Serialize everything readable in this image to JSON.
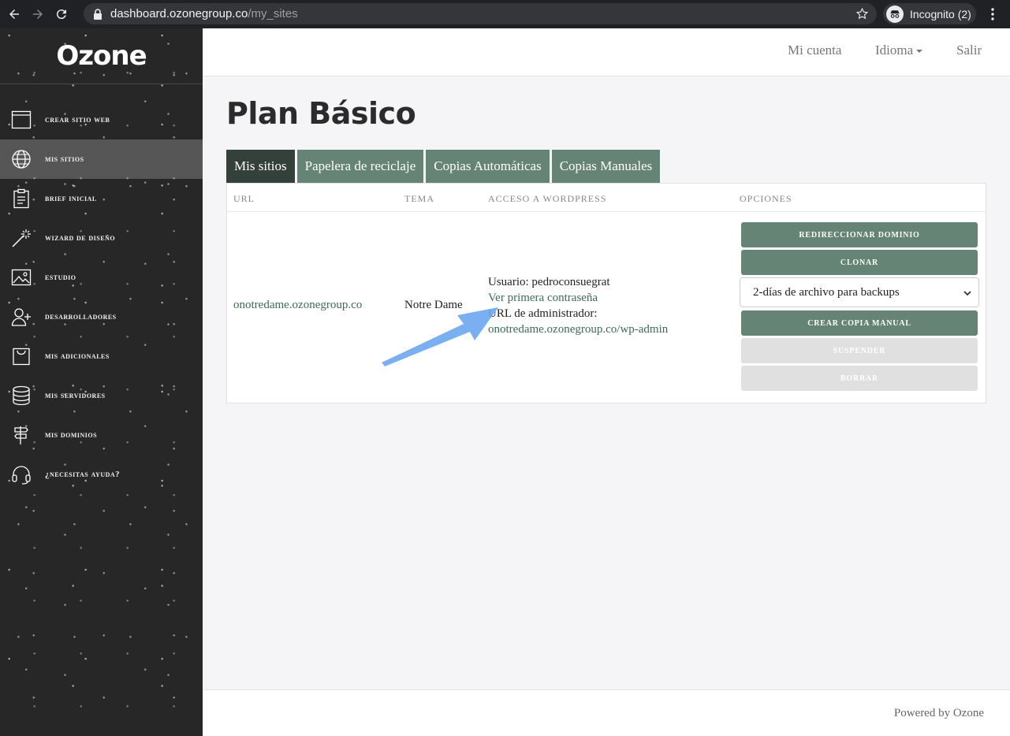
{
  "browser": {
    "url_host": "dashboard.ozonegroup.co",
    "url_path": "/my_sites",
    "incognito_label": "Incognito (2)"
  },
  "sidebar": {
    "logo": "Ozone",
    "items": [
      {
        "label": "Crear sitio web",
        "icon": "browser-window-icon"
      },
      {
        "label": "Mis sitios",
        "icon": "globe-icon",
        "active": true
      },
      {
        "label": "Brief inicial",
        "icon": "clipboard-icon"
      },
      {
        "label": "Wizard de diseño",
        "icon": "magic-wand-icon"
      },
      {
        "label": "Estudio",
        "icon": "image-icon"
      },
      {
        "label": "Desarrolladores",
        "icon": "add-user-icon"
      },
      {
        "label": "Mis adicionales",
        "icon": "shopping-bag-icon"
      },
      {
        "label": "Mis servidores",
        "icon": "database-icon"
      },
      {
        "label": "Mis dominios",
        "icon": "signpost-icon"
      },
      {
        "label": "¿Necesitas ayuda?",
        "icon": "headset-icon"
      }
    ]
  },
  "topnav": {
    "account": "Mi cuenta",
    "language": "Idioma",
    "logout": "Salir"
  },
  "main": {
    "title": "Plan Básico",
    "tabs": [
      "Mis sitios",
      "Papelera de reciclaje",
      "Copias Automáticas",
      "Copias Manuales"
    ],
    "table": {
      "headers": [
        "URL",
        "TEMA",
        "ACCESO A WORDPRESS",
        "OPCIONES"
      ],
      "row": {
        "url": "onotredame.ozonegroup.co",
        "theme": "Notre Dame",
        "user_line": "Usuario: pedroconsuegrat",
        "password_link": "Ver primera contraseña",
        "admin_label": "URL de administrador:",
        "admin_url": "onotredame.ozonegroup.co/wp-admin"
      }
    },
    "options": {
      "redirect": "REDIRECCIONAR DOMINIO",
      "clone": "CLONAR",
      "backup_select": "2-días de archivo para backups",
      "manual_copy": "CREAR COPIA MANUAL",
      "suspend": "SUSPENDER",
      "delete": "BORRAR"
    }
  },
  "footer": {
    "text": "Powered by Ozone"
  },
  "colors": {
    "accent_green": "#668475",
    "active_tab": "#34413b",
    "link_green": "#3d6b52",
    "arrow_blue": "#6fa8f0"
  }
}
